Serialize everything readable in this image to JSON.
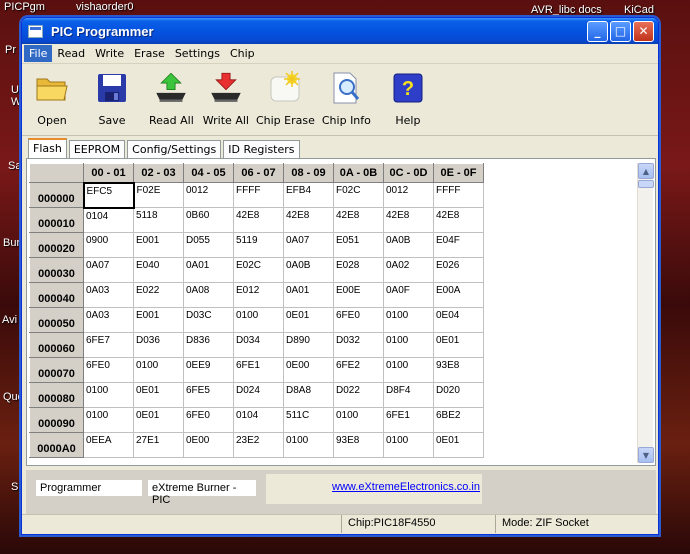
{
  "desktop": {
    "labels": {
      "picgm": "PICPgm",
      "vishaorder": "vishaorder0",
      "avr": "AVR_libc docs",
      "kicad": "KiCad",
      "pr": "Pr",
      "u": "U",
      "w": "W",
      "sa": "Sa",
      "bur": "Bur",
      "avi": "Avi",
      "quo": "Quo",
      "s": "S"
    }
  },
  "window": {
    "title": "PIC Programmer",
    "controls": {
      "minimize": "_",
      "maximize": "□",
      "close": "✕"
    }
  },
  "menu": [
    "File",
    "Read",
    "Write",
    "Erase",
    "Settings",
    "Chip"
  ],
  "toolbar": [
    {
      "label": "Open",
      "icon": "folder-icon"
    },
    {
      "label": "Save",
      "icon": "floppy-disk-icon"
    },
    {
      "label": "Read All",
      "icon": "read-chip-icon"
    },
    {
      "label": "Write All",
      "icon": "write-chip-icon"
    },
    {
      "label": "Chip Erase",
      "icon": "erase-chip-icon"
    },
    {
      "label": "Chip Info",
      "icon": "chip-info-icon"
    },
    {
      "label": "Help",
      "icon": "help-icon"
    }
  ],
  "tabs": [
    "Flash",
    "EEPROM",
    "Config/Settings",
    "ID Registers"
  ],
  "selected_tab": "Flash",
  "grid": {
    "columns": [
      "00 - 01",
      "02 - 03",
      "04 - 05",
      "06 - 07",
      "08 - 09",
      "0A - 0B",
      "0C - 0D",
      "0E - 0F"
    ],
    "rows": [
      {
        "addr": "000000",
        "cells": [
          "EFC5",
          "F02E",
          "0012",
          "FFFF",
          "EFB4",
          "F02C",
          "0012",
          "FFFF"
        ]
      },
      {
        "addr": "000010",
        "cells": [
          "0104",
          "5118",
          "0B60",
          "42E8",
          "42E8",
          "42E8",
          "42E8",
          "42E8"
        ]
      },
      {
        "addr": "000020",
        "cells": [
          "0900",
          "E001",
          "D055",
          "5119",
          "0A07",
          "E051",
          "0A0B",
          "E04F"
        ]
      },
      {
        "addr": "000030",
        "cells": [
          "0A07",
          "E040",
          "0A01",
          "E02C",
          "0A0B",
          "E028",
          "0A02",
          "E026"
        ]
      },
      {
        "addr": "000040",
        "cells": [
          "0A03",
          "E022",
          "0A08",
          "E012",
          "0A01",
          "E00E",
          "0A0F",
          "E00A"
        ]
      },
      {
        "addr": "000050",
        "cells": [
          "0A03",
          "E001",
          "D03C",
          "0100",
          "0E01",
          "6FE0",
          "0100",
          "0E04"
        ]
      },
      {
        "addr": "000060",
        "cells": [
          "6FE7",
          "D036",
          "D836",
          "D034",
          "D890",
          "D032",
          "0100",
          "0E01"
        ]
      },
      {
        "addr": "000070",
        "cells": [
          "6FE0",
          "0100",
          "0EE9",
          "6FE1",
          "0E00",
          "6FE2",
          "0100",
          "93E8"
        ]
      },
      {
        "addr": "000080",
        "cells": [
          "0100",
          "0E01",
          "6FE5",
          "D024",
          "D8A8",
          "D022",
          "D8F4",
          "D020"
        ]
      },
      {
        "addr": "000090",
        "cells": [
          "0100",
          "0E01",
          "6FE0",
          "0104",
          "511C",
          "0100",
          "6FE1",
          "6BE2"
        ]
      },
      {
        "addr": "0000A0",
        "cells": [
          "0EEA",
          "27E1",
          "0E00",
          "23E2",
          "0100",
          "93E8",
          "0100",
          "0E01"
        ]
      }
    ]
  },
  "lower": {
    "programmer_label": "Programmer",
    "programmer_value": "eXtreme Burner - PIC",
    "link": "www.eXtremeElectronics.co.in"
  },
  "status": {
    "chip": "Chip:PIC18F4550",
    "mode": "Mode: ZIF Socket"
  }
}
